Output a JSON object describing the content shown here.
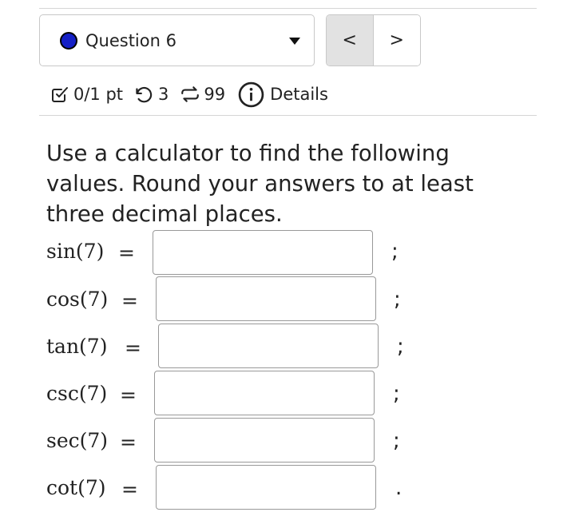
{
  "question_selector": {
    "label": "Question 6",
    "status_color": "#1520c6"
  },
  "nav": {
    "prev_label": "<",
    "next_label": ">"
  },
  "meta": {
    "points": "0/1 pt",
    "retries": "3",
    "submissions": "99",
    "details_label": "Details"
  },
  "prompt": "Use a calculator to find the following values. Round your answers to at least three decimal places.",
  "rows": [
    {
      "func": "sin(7)",
      "eq": "=",
      "value": "",
      "sep": ";"
    },
    {
      "func": "cos(7)",
      "eq": "=",
      "value": "",
      "sep": ";"
    },
    {
      "func": "tan(7)",
      "eq": "=",
      "value": "",
      "sep": ";"
    },
    {
      "func": "csc(7)",
      "eq": "=",
      "value": "",
      "sep": ";"
    },
    {
      "func": "sec(7)",
      "eq": "=",
      "value": "",
      "sep": ";"
    },
    {
      "func": "cot(7)",
      "eq": "=",
      "value": "",
      "sep": "."
    }
  ]
}
